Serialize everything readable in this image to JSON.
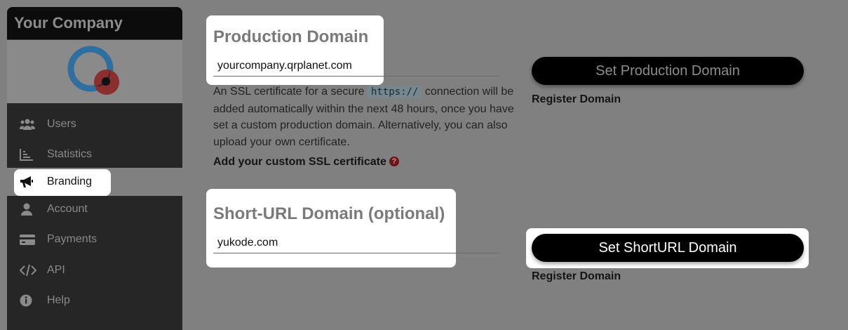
{
  "sidebar": {
    "company_name": "Your Company",
    "items": [
      {
        "label": "Users",
        "icon": "users-icon"
      },
      {
        "label": "Statistics",
        "icon": "chart-icon"
      },
      {
        "label": "Branding",
        "icon": "megaphone-icon",
        "active": true
      },
      {
        "label": "Account",
        "icon": "user-icon"
      },
      {
        "label": "Payments",
        "icon": "credit-card-icon"
      },
      {
        "label": "API",
        "icon": "code-icon"
      },
      {
        "label": "Help",
        "icon": "info-icon"
      }
    ]
  },
  "production": {
    "title": "Production Domain",
    "value": "yourcompany.qrplanet.com",
    "description_before": "An SSL certificate for a secure ",
    "description_code": "https://",
    "description_after": " connection will be added automatically within the next 48 hours, once you have set a custom production domain. Alternatively, you can also upload your own certificate.",
    "ssl_link": "Add your custom SSL certificate",
    "help_badge": "?",
    "button_label": "Set Production Domain",
    "register_link": "Register Domain"
  },
  "shorturl": {
    "title": "Short-URL Domain (optional)",
    "value": "yukode.com",
    "button_label": "Set ShortURL Domain",
    "register_link": "Register Domain"
  },
  "colors": {
    "overlay_background": "#808080",
    "sidebar_background": "#262626",
    "button_background": "#000000",
    "highlight": "#ffffff"
  }
}
